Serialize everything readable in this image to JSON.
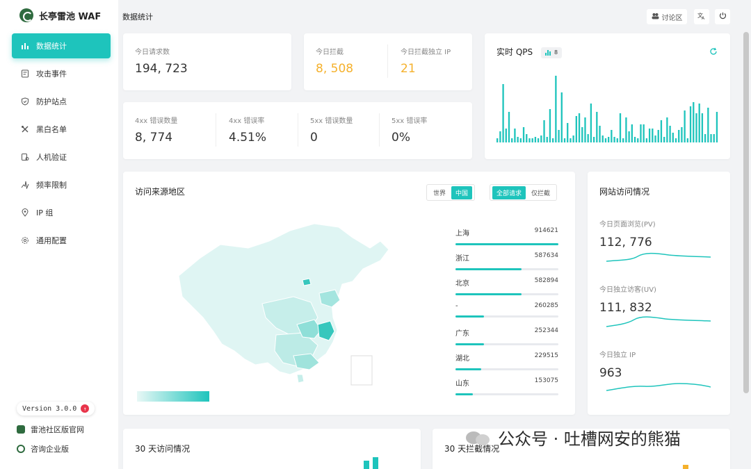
{
  "brand": {
    "name": "长亭雷池 WAF"
  },
  "nav": [
    {
      "label": "数据统计",
      "icon": "bar-chart-icon",
      "active": true
    },
    {
      "label": "攻击事件",
      "icon": "document-icon",
      "active": false
    },
    {
      "label": "防护站点",
      "icon": "shield-icon",
      "active": false
    },
    {
      "label": "黑白名单",
      "icon": "tools-icon",
      "active": false
    },
    {
      "label": "人机验证",
      "icon": "user-check-icon",
      "active": false
    },
    {
      "label": "频率限制",
      "icon": "pulse-icon",
      "active": false
    },
    {
      "label": "IP 组",
      "icon": "location-icon",
      "active": false
    },
    {
      "label": "通用配置",
      "icon": "gear-icon",
      "active": false
    }
  ],
  "version": {
    "label": "Version 3.0.0",
    "badge": "↑"
  },
  "footer": {
    "community_link": "雷池社区版官网",
    "enterprise_link": "咨询企业版"
  },
  "topbar": {
    "title": "数据统计",
    "discuss_label": "讨论区"
  },
  "stats": {
    "requests": {
      "label": "今日请求数",
      "value": "194, 723"
    },
    "blocked": {
      "label": "今日拦截",
      "value": "8, 508"
    },
    "blocked_ip": {
      "label": "今日拦截独立 IP",
      "value": "21"
    },
    "err4_count": {
      "label": "4xx 错误数量",
      "value": "8, 774"
    },
    "err4_rate": {
      "label": "4xx 错误率",
      "value": "4.51%"
    },
    "err5_count": {
      "label": "5xx 错误数量",
      "value": "0"
    },
    "err5_rate": {
      "label": "5xx 错误率",
      "value": "0%"
    }
  },
  "qps": {
    "title": "实时 QPS",
    "badge_value": "8",
    "color": "#1ec4bc",
    "values": [
      3,
      8,
      42,
      10,
      22,
      3,
      10,
      4,
      3,
      11,
      6,
      3,
      3,
      4,
      3,
      5,
      16,
      4,
      24,
      3,
      48,
      9,
      36,
      3,
      14,
      3,
      5,
      19,
      21,
      11,
      18,
      6,
      28,
      4,
      22,
      12,
      5,
      3,
      4,
      9,
      4,
      3,
      21,
      3,
      18,
      8,
      13,
      4,
      3,
      13,
      13,
      3,
      10,
      10,
      5,
      9,
      16,
      4,
      18,
      12,
      7,
      3,
      9,
      11,
      23,
      3,
      26,
      29,
      21,
      28,
      21,
      6,
      25,
      6,
      6,
      22
    ]
  },
  "region": {
    "title": "访问来源地区",
    "scope_options": [
      "世界",
      "中国"
    ],
    "scope_selected": "中国",
    "filter_options": [
      "全部请求",
      "仅拦截"
    ],
    "filter_selected": "全部请求",
    "rows": [
      {
        "name": "上海",
        "value": "914621",
        "fraction": 1.0
      },
      {
        "name": "浙江",
        "value": "587634",
        "fraction": 0.64
      },
      {
        "name": "北京",
        "value": "582894",
        "fraction": 0.64
      },
      {
        "name": "-",
        "value": "260285",
        "fraction": 0.28
      },
      {
        "name": "广东",
        "value": "252344",
        "fraction": 0.28
      },
      {
        "name": "湖北",
        "value": "229515",
        "fraction": 0.25
      },
      {
        "name": "山东",
        "value": "153075",
        "fraction": 0.17
      }
    ]
  },
  "site": {
    "title": "网站访问情况",
    "pv": {
      "label": "今日页面浏览(PV)",
      "value": "112, 776"
    },
    "uv": {
      "label": "今日独立访客(UV)",
      "value": "111, 832"
    },
    "ip": {
      "label": "今日独立 IP",
      "value": "963"
    }
  },
  "bottom": {
    "visits_title": "30 天访问情况",
    "blocks_title": "30 天拦截情况"
  },
  "watermark": {
    "text": "公众号 · 吐槽网安的熊猫"
  }
}
